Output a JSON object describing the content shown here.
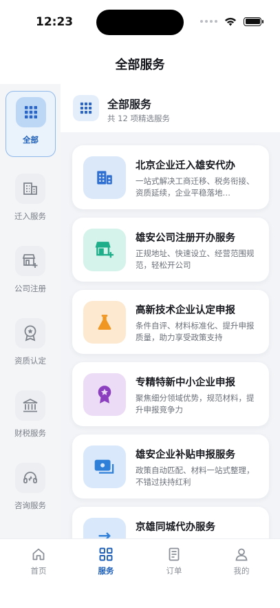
{
  "status_bar": {
    "time": "12:23"
  },
  "header": {
    "title": "全部服务"
  },
  "sidebar": {
    "items": [
      {
        "label": "全部",
        "icon": "grid-icon"
      },
      {
        "label": "迁入服务",
        "icon": "building-icon"
      },
      {
        "label": "公司注册",
        "icon": "store-add-icon"
      },
      {
        "label": "资质认定",
        "icon": "badge-icon"
      },
      {
        "label": "财税服务",
        "icon": "bank-icon"
      },
      {
        "label": "咨询服务",
        "icon": "headset-icon"
      }
    ]
  },
  "main": {
    "title": "全部服务",
    "subtitle": "共 12 项精选服务",
    "services": [
      {
        "title": "北京企业迁入雄安代办",
        "desc": "一站式解决工商迁移、税务衔接、资质延续，企业平稳落地…",
        "icon": "building-icon",
        "color": "#2f6fd1"
      },
      {
        "title": "雄安公司注册开办服务",
        "desc": "正规地址、快速设立、经营范围规范，轻松开公司",
        "icon": "store-add-icon",
        "color": "#1eae8a"
      },
      {
        "title": "高新技术企业认定申报",
        "desc": "条件自评、材料标准化、提升申报质量，助力享受政策支持",
        "icon": "flask-icon",
        "color": "#ef9722"
      },
      {
        "title": "专精特新中小企业申报",
        "desc": "聚焦细分领域优势，规范材料，提升申报竞争力",
        "icon": "award-icon",
        "color": "#8c3fbf"
      },
      {
        "title": "雄安企业补贴申报服务",
        "desc": "政策自动匹配、材料一站式整理，不错过扶持红利",
        "icon": "money-icon",
        "color": "#2f7fd8"
      },
      {
        "title": "京雄同城代办服务",
        "desc": "",
        "icon": "transfer-icon",
        "color": "#2f7fd8"
      }
    ]
  },
  "tabbar": {
    "items": [
      {
        "label": "首页",
        "icon": "home-icon"
      },
      {
        "label": "服务",
        "icon": "grid-icon"
      },
      {
        "label": "订单",
        "icon": "document-icon"
      },
      {
        "label": "我的",
        "icon": "user-icon"
      }
    ]
  }
}
